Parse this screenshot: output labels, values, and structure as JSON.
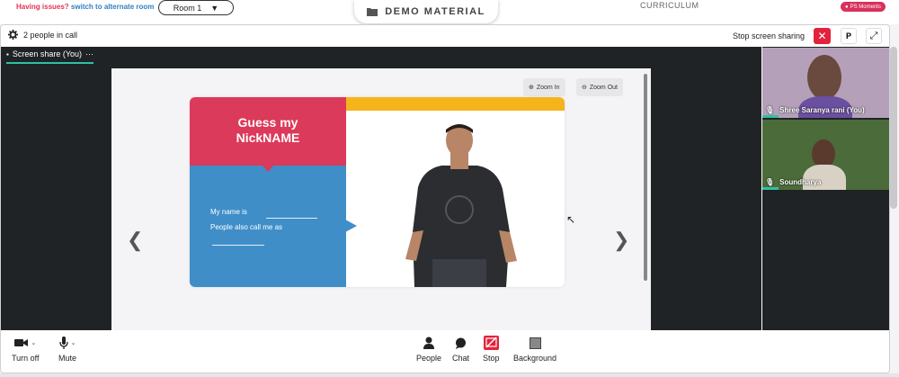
{
  "topbar": {
    "issue_text": "Having issues?",
    "issue_link": "switch to alternate room",
    "room_label": "Room 1",
    "demo_label": "DEMO MATERIAL",
    "curriculum_label": "CURRICULUM",
    "moments_label": "PS Moments"
  },
  "callheader": {
    "people_count": "2 people in call",
    "stop_share": "Stop screen sharing",
    "p_label": "P"
  },
  "stage": {
    "screen_tab": "Screen share (You)",
    "more_label": "···",
    "zoom_in": "Zoom In",
    "zoom_out": "Zoom Out"
  },
  "slide": {
    "title_line1": "Guess my",
    "title_line2": "NickNAME",
    "name_line": "My name is",
    "also_line": "People also call me as"
  },
  "participants": [
    {
      "name": "Shree Saranya rani (You)"
    },
    {
      "name": "Soundharya"
    }
  ],
  "controls": {
    "turn_off": "Turn off",
    "mute": "Mute",
    "people": "People",
    "chat": "Chat",
    "stop": "Stop",
    "background": "Background"
  },
  "colors": {
    "accent_red": "#dc3a5a",
    "accent_blue": "#3f8ec8",
    "accent_yellow": "#f5b41b",
    "active_green": "#2fc0a0",
    "stop_red": "#e3223b"
  }
}
